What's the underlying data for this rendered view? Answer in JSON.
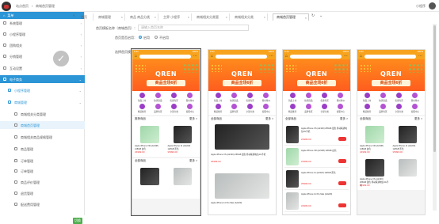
{
  "topbar": {
    "crumb_home": "站点首页",
    "crumb_sep": "/",
    "crumb_current": "商城首页管理",
    "username": "小程序"
  },
  "sidebar": {
    "header": "菜单",
    "items": [
      {
        "label": "系统管理",
        "level": 0
      },
      {
        "label": "小程序管理",
        "level": 0
      },
      {
        "label": "团购相关",
        "level": 0
      },
      {
        "label": "分销管理",
        "level": 0
      },
      {
        "label": "互动设置",
        "level": 0
      },
      {
        "label": "电子商务",
        "level": 0,
        "state": "active"
      },
      {
        "label": "小程序管理",
        "level": 1
      },
      {
        "label": "商城管理",
        "level": 1
      },
      {
        "label": "商城相关分类管理",
        "level": 2
      },
      {
        "label": "商城首页管理",
        "level": 2,
        "state": "selected"
      },
      {
        "label": "商城相关商品规格管理",
        "level": 2
      },
      {
        "label": "商品管理",
        "level": 2
      },
      {
        "label": "订单管理",
        "level": 2
      },
      {
        "label": "订单管理",
        "level": 2
      },
      {
        "label": "商品评价管理",
        "level": 2
      },
      {
        "label": "退货管理",
        "level": 2
      },
      {
        "label": "配送费用管理",
        "level": 2
      }
    ],
    "green_button": "切换"
  },
  "tabs": [
    {
      "label": "首页"
    },
    {
      "label": "商城管理"
    },
    {
      "label": "商品 商品分类"
    },
    {
      "label": "主界 小程序"
    },
    {
      "label": "商城相关分类管"
    },
    {
      "label": "商城相关分类"
    },
    {
      "label": "商城首页管理",
      "active": true
    }
  ],
  "form": {
    "name_label": "首页模板名称（商城首页）：",
    "name_placeholder": "请输入首页名称",
    "enable_label": "首页是否启用：",
    "radio_yes": "启用",
    "radio_no": "不启用",
    "template_label": "选择首页模板："
  },
  "phone": {
    "time": "9:41",
    "battery": "100%",
    "banner_big": "QREN",
    "banner_sub": "商品全场6折",
    "icon_labels": [
      "新品上市",
      "热销商品",
      "优惠专区",
      "限时特价",
      "精选推荐",
      "品牌专区",
      "全部分类",
      "客服中心"
    ],
    "recommend_title": "推荐商品",
    "all_title": "全部商品",
    "more": "更多 >",
    "product_name_1": "Apple iPhone XR (A2108) 128GB 白色",
    "product_name_2": "Apple iPhone 11 (A2223) 128GB 黑色",
    "product_name_3": "Apple iPhone XS (A2100) 256GB 银色 移动联通电信4G手机",
    "product_name_4": "Apple iPhone 11 Pro Max (A2220)",
    "price": "¥4999.00",
    "price_2": "¥5999.00"
  },
  "colors": {
    "primary": "#2b95d6",
    "banner_orange": "#f7a31e",
    "icon_purple": "#9b3ec7",
    "price_red": "#ee3333"
  }
}
